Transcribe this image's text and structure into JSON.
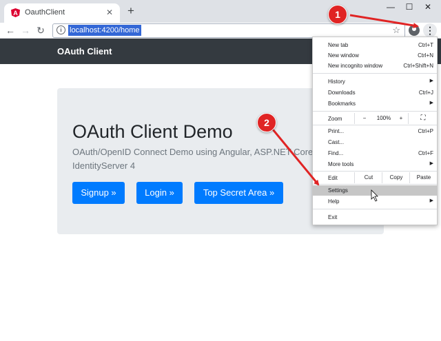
{
  "tab": {
    "title": "OauthClient",
    "close": "✕",
    "new_tab": "+"
  },
  "window": {
    "minimize": "—",
    "maximize": "☐",
    "close": "✕"
  },
  "toolbar": {
    "back": "←",
    "forward": "→",
    "reload": "↻",
    "url": "localhost:4200/home",
    "menu": "⋮"
  },
  "page": {
    "brand": "OAuth Client",
    "title": "OAuth Client Demo",
    "lead": "OAuth/OpenID Connect Demo using Angular, ASP.NET Core and IdentityServer 4",
    "buttons": [
      "Signup »",
      "Login »",
      "Top Secret Area »"
    ]
  },
  "menu": {
    "new_tab": {
      "label": "New tab",
      "shortcut": "Ctrl+T"
    },
    "new_window": {
      "label": "New window",
      "shortcut": "Ctrl+N"
    },
    "incognito": {
      "label": "New incognito window",
      "shortcut": "Ctrl+Shift+N"
    },
    "history": {
      "label": "History"
    },
    "downloads": {
      "label": "Downloads",
      "shortcut": "Ctrl+J"
    },
    "bookmarks": {
      "label": "Bookmarks"
    },
    "zoom": {
      "label": "Zoom",
      "minus": "−",
      "value": "100%",
      "plus": "+",
      "fullscreen": "⛶"
    },
    "print": {
      "label": "Print...",
      "shortcut": "Ctrl+P"
    },
    "cast": {
      "label": "Cast..."
    },
    "find": {
      "label": "Find...",
      "shortcut": "Ctrl+F"
    },
    "more_tools": {
      "label": "More tools"
    },
    "edit": {
      "label": "Edit",
      "cut": "Cut",
      "copy": "Copy",
      "paste": "Paste"
    },
    "settings": {
      "label": "Settings"
    },
    "help": {
      "label": "Help"
    },
    "exit": {
      "label": "Exit"
    },
    "submenu_arrow": "▶"
  },
  "annotations": {
    "step1": "1",
    "step2": "2",
    "color": "#e02424"
  }
}
